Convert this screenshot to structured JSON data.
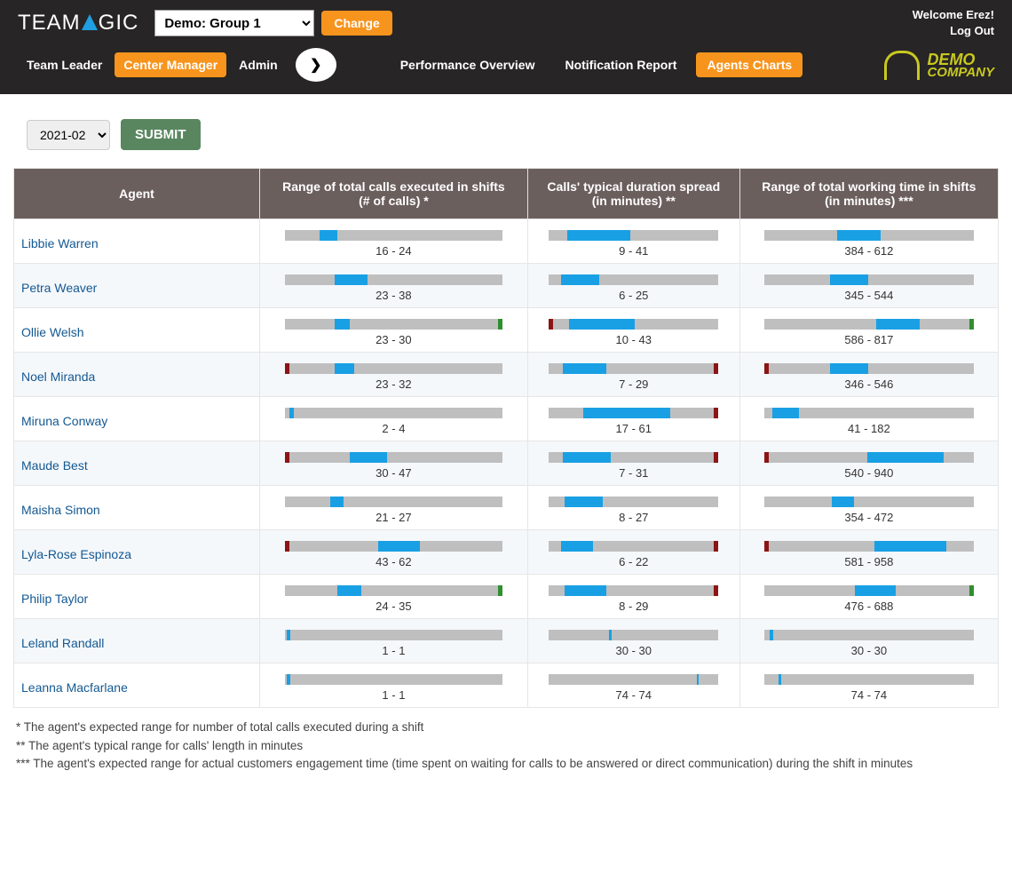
{
  "header": {
    "brand_before": "TEAM",
    "brand_after": "GIC",
    "group_selected": "Demo: Group 1",
    "change_btn": "Change",
    "welcome": "Welcome Erez!",
    "logout": "Log Out",
    "demo_company_top": "DEMO",
    "demo_company_bottom": "COMPANY"
  },
  "nav": {
    "roles": [
      "Team Leader",
      "Center Manager",
      "Admin"
    ],
    "active_role": 1,
    "views": [
      "Performance Overview",
      "Notification Report",
      "Agents Charts"
    ],
    "active_view": 2
  },
  "controls": {
    "period_selected": "2021-02",
    "submit_label": "SUBMIT"
  },
  "table": {
    "headers": {
      "agent": "Agent",
      "calls": "Range of total calls executed in shifts\n(# of calls) *",
      "duration": "Calls' typical duration spread\n(in minutes) **",
      "worktime": "Range of total working time in shifts\n(in minutes) ***"
    }
  },
  "axis": {
    "calls": {
      "min": 0,
      "max": 100
    },
    "duration": {
      "min": 0,
      "max": 85
    },
    "work": {
      "min": 0,
      "max": 1100
    }
  },
  "agents": [
    {
      "name": "Libbie Warren",
      "calls": {
        "lo": 16,
        "hi": 24,
        "min": false,
        "max": null
      },
      "dur": {
        "lo": 9,
        "hi": 41,
        "min": false,
        "max": null
      },
      "work": {
        "lo": 384,
        "hi": 612,
        "min": false,
        "max": null
      }
    },
    {
      "name": "Petra Weaver",
      "calls": {
        "lo": 23,
        "hi": 38,
        "min": false,
        "max": null
      },
      "dur": {
        "lo": 6,
        "hi": 25,
        "min": false,
        "max": null
      },
      "work": {
        "lo": 345,
        "hi": 544,
        "min": false,
        "max": null
      }
    },
    {
      "name": "Ollie Welsh",
      "calls": {
        "lo": 23,
        "hi": 30,
        "min": false,
        "max": "grn"
      },
      "dur": {
        "lo": 10,
        "hi": 43,
        "min": true,
        "max": null
      },
      "work": {
        "lo": 586,
        "hi": 817,
        "min": false,
        "max": "grn"
      }
    },
    {
      "name": "Noel Miranda",
      "calls": {
        "lo": 23,
        "hi": 32,
        "min": true,
        "max": null
      },
      "dur": {
        "lo": 7,
        "hi": 29,
        "min": false,
        "max": "red"
      },
      "work": {
        "lo": 346,
        "hi": 546,
        "min": true,
        "max": null
      }
    },
    {
      "name": "Miruna Conway",
      "calls": {
        "lo": 2,
        "hi": 4,
        "min": false,
        "max": null
      },
      "dur": {
        "lo": 17,
        "hi": 61,
        "min": false,
        "max": "red"
      },
      "work": {
        "lo": 41,
        "hi": 182,
        "min": false,
        "max": null
      }
    },
    {
      "name": "Maude Best",
      "calls": {
        "lo": 30,
        "hi": 47,
        "min": true,
        "max": null
      },
      "dur": {
        "lo": 7,
        "hi": 31,
        "min": false,
        "max": "red"
      },
      "work": {
        "lo": 540,
        "hi": 940,
        "min": true,
        "max": null
      }
    },
    {
      "name": "Maisha Simon",
      "calls": {
        "lo": 21,
        "hi": 27,
        "min": false,
        "max": null
      },
      "dur": {
        "lo": 8,
        "hi": 27,
        "min": false,
        "max": null
      },
      "work": {
        "lo": 354,
        "hi": 472,
        "min": false,
        "max": null
      }
    },
    {
      "name": "Lyla-Rose Espinoza",
      "calls": {
        "lo": 43,
        "hi": 62,
        "min": true,
        "max": null
      },
      "dur": {
        "lo": 6,
        "hi": 22,
        "min": false,
        "max": "red"
      },
      "work": {
        "lo": 581,
        "hi": 958,
        "min": true,
        "max": null
      }
    },
    {
      "name": "Philip Taylor",
      "calls": {
        "lo": 24,
        "hi": 35,
        "min": false,
        "max": "grn"
      },
      "dur": {
        "lo": 8,
        "hi": 29,
        "min": false,
        "max": "red"
      },
      "work": {
        "lo": 476,
        "hi": 688,
        "min": false,
        "max": "grn"
      }
    },
    {
      "name": "Leland Randall",
      "calls": {
        "lo": 1,
        "hi": 1,
        "min": false,
        "max": null
      },
      "dur": {
        "lo": 30,
        "hi": 30,
        "min": false,
        "max": null
      },
      "work": {
        "lo": 30,
        "hi": 30,
        "min": false,
        "max": null
      }
    },
    {
      "name": "Leanna Macfarlane",
      "calls": {
        "lo": 1,
        "hi": 1,
        "min": false,
        "max": null
      },
      "dur": {
        "lo": 74,
        "hi": 74,
        "min": false,
        "max": null
      },
      "work": {
        "lo": 74,
        "hi": 74,
        "min": false,
        "max": null
      }
    }
  ],
  "footnotes": [
    "* The agent's expected range for number of total calls executed during a shift",
    "** The agent's typical range for calls' length in minutes",
    "*** The agent's expected range for actual customers engagement time (time spent on waiting for calls to be answered or direct communication) during the shift in minutes"
  ],
  "chart_data": {
    "type": "table",
    "title": "Agents Charts — 2021-02",
    "columns": [
      "Agent",
      "calls_lo",
      "calls_hi",
      "duration_lo_min",
      "duration_hi_min",
      "work_lo_min",
      "work_hi_min"
    ],
    "rows": [
      [
        "Libbie Warren",
        16,
        24,
        9,
        41,
        384,
        612
      ],
      [
        "Petra Weaver",
        23,
        38,
        6,
        25,
        345,
        544
      ],
      [
        "Ollie Welsh",
        23,
        30,
        10,
        43,
        586,
        817
      ],
      [
        "Noel Miranda",
        23,
        32,
        7,
        29,
        346,
        546
      ],
      [
        "Miruna Conway",
        2,
        4,
        17,
        61,
        41,
        182
      ],
      [
        "Maude Best",
        30,
        47,
        7,
        31,
        540,
        940
      ],
      [
        "Maisha Simon",
        21,
        27,
        8,
        27,
        354,
        472
      ],
      [
        "Lyla-Rose Espinoza",
        43,
        62,
        6,
        22,
        581,
        958
      ],
      [
        "Philip Taylor",
        24,
        35,
        8,
        29,
        476,
        688
      ],
      [
        "Leland Randall",
        1,
        1,
        30,
        30,
        30,
        30
      ],
      [
        "Leanna Macfarlane",
        1,
        1,
        74,
        74,
        74,
        74
      ]
    ]
  }
}
